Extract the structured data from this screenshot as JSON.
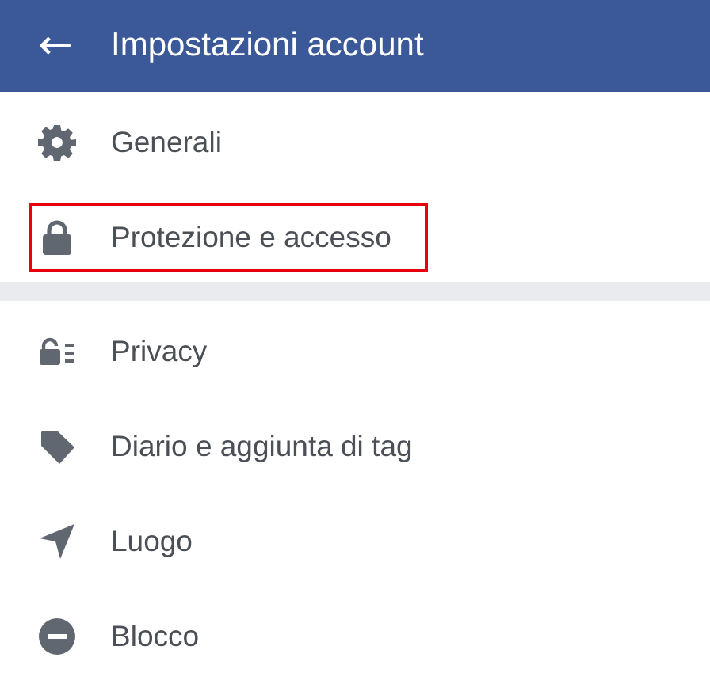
{
  "header": {
    "back": "←",
    "title": "Impostazioni account"
  },
  "sections": [
    {
      "items": [
        {
          "kind": "gear",
          "label": "Generali",
          "highlighted": false
        },
        {
          "kind": "lock",
          "label": "Protezione e accesso",
          "highlighted": true
        }
      ]
    },
    {
      "items": [
        {
          "kind": "privacy",
          "label": "Privacy",
          "highlighted": false
        },
        {
          "kind": "tag",
          "label": "Diario e aggiunta di tag",
          "highlighted": false
        },
        {
          "kind": "location",
          "label": "Luogo",
          "highlighted": false
        },
        {
          "kind": "block",
          "label": "Blocco",
          "highlighted": false
        }
      ]
    }
  ]
}
